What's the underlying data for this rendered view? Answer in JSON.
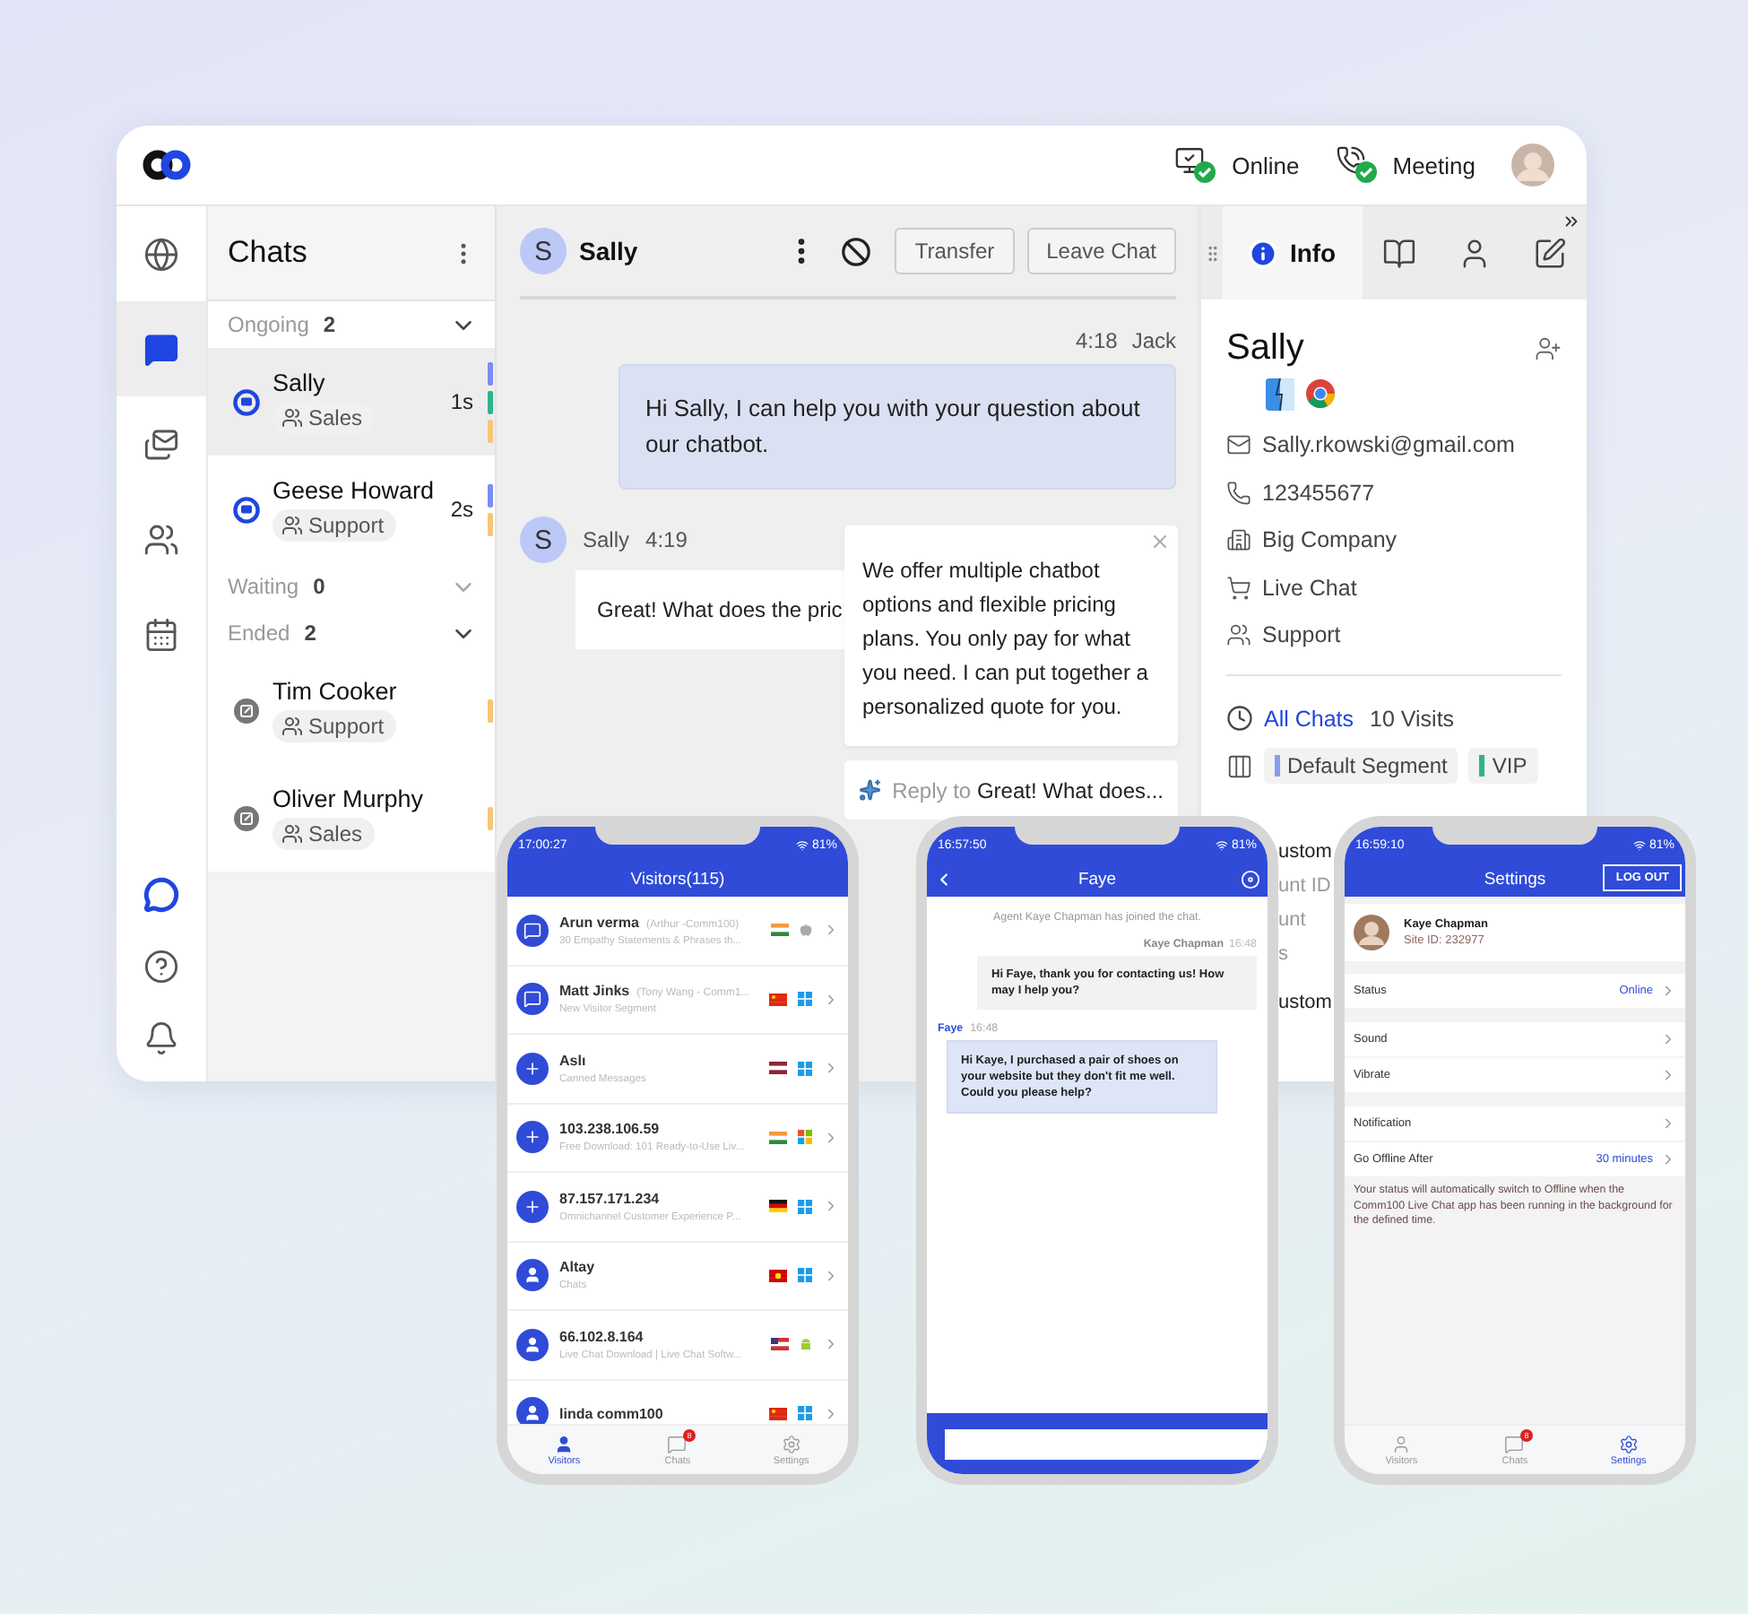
{
  "topbar": {
    "statuses": [
      {
        "kind": "online",
        "label": "Online"
      },
      {
        "kind": "meeting",
        "label": "Meeting"
      }
    ]
  },
  "nav": {
    "items": [
      {
        "kind": "globe",
        "selected": false
      },
      {
        "kind": "chats",
        "selected": true
      },
      {
        "kind": "messages",
        "selected": false
      },
      {
        "kind": "teams",
        "selected": false
      },
      {
        "kind": "calendar",
        "selected": false
      }
    ],
    "bottom": [
      {
        "kind": "brand"
      },
      {
        "kind": "help"
      },
      {
        "kind": "notifications"
      }
    ]
  },
  "chat_list": {
    "title": "Chats",
    "sections": [
      {
        "label": "Ongoing",
        "count": "2",
        "items": [
          {
            "kind": "active",
            "name": "Sally",
            "tag": "Sales",
            "time": "1s",
            "selected": true,
            "marks": [
              {
                "color": "#7b8cf5"
              },
              {
                "color": "#2bb58e"
              },
              {
                "color": "#f6c576"
              }
            ]
          },
          {
            "kind": "active",
            "name": "Geese Howard",
            "tag": "Support",
            "time": "2s",
            "selected": false,
            "marks": [
              {
                "color": "#7b8cf5"
              },
              {
                "color": "#f6c576"
              }
            ]
          }
        ]
      },
      {
        "label": "Waiting",
        "count": "0"
      },
      {
        "label": "Ended",
        "count": "2",
        "items": [
          {
            "kind": "ended",
            "name": "Tim Cooker",
            "tag": "Support",
            "selected": false,
            "marks": [
              {
                "color": "#f6c576"
              }
            ]
          },
          {
            "kind": "ended",
            "name": "Oliver Murphy",
            "tag": "Sales",
            "selected": false,
            "marks": [
              {
                "color": "#f6c576"
              }
            ]
          }
        ]
      }
    ]
  },
  "conversation": {
    "contact": {
      "initial": "S",
      "name": "Sally"
    },
    "actions": [
      "Transfer",
      "Leave Chat"
    ],
    "messages": [
      {
        "kind": "agent",
        "time": "4:18",
        "author": "Jack",
        "text": "Hi Sally, I can help you with your question about our chatbot."
      },
      {
        "kind": "visitor",
        "initial": "S",
        "author": "Sally",
        "time": "4:19",
        "text": "Great! What does the pric"
      }
    ],
    "suggestion": {
      "text": "We offer multiple chatbot options and flexible pricing plans. You only pay for what you need. I can put together a personalized quote for you."
    },
    "reply": {
      "prefix": "Reply to",
      "quote": "Great! What does..."
    }
  },
  "info": {
    "tabs": [
      {
        "kind": "info",
        "label": "Info",
        "selected": true
      },
      {
        "kind": "book",
        "selected": false
      },
      {
        "kind": "person",
        "selected": false
      },
      {
        "kind": "notes",
        "selected": false
      }
    ],
    "name": "Sally",
    "details": [
      {
        "kind": "email",
        "text": "Sally.rkowski@gmail.com"
      },
      {
        "kind": "phone",
        "text": "123455677"
      },
      {
        "kind": "company",
        "text": "Big Company"
      },
      {
        "kind": "cart",
        "text": "Live Chat"
      },
      {
        "kind": "team",
        "text": "Support"
      }
    ],
    "history": {
      "link": "All Chats",
      "visits": "10 Visits"
    },
    "segments": [
      {
        "label": "Default Segment",
        "color": "#8a9cf0"
      },
      {
        "label": "VIP",
        "color": "#2bb58e"
      }
    ],
    "fragments": [
      {
        "kind": "heading",
        "text": "ustom"
      },
      {
        "kind": "field",
        "text": "unt ID"
      },
      {
        "kind": "field",
        "text": "unt"
      },
      {
        "kind": "field",
        "text": "s"
      },
      {
        "kind": "heading",
        "text": "ustom"
      }
    ]
  },
  "phones": [
    {
      "kind": "visitors",
      "clock": "17:00:27",
      "battery": "81%",
      "title": "Visitors(115)",
      "visitors": [
        {
          "kind": "chat",
          "name": "Arun verma",
          "alias": "(Arthur -Comm100)",
          "subtitle": "30 Empathy Statements & Phrases th...",
          "flag": {
            "kind": "india"
          },
          "os": {
            "kind": "apple"
          }
        },
        {
          "kind": "chat",
          "name": "Matt Jinks",
          "alias": "(Tony Wang - Comm1...",
          "subtitle": "New Visitor Segment",
          "flag": {
            "kind": "china"
          },
          "os": {
            "kind": "windows"
          }
        },
        {
          "kind": "plus",
          "name": "Aslı",
          "subtitle": "Canned Messages",
          "flag": {
            "kind": "latvia"
          },
          "os": {
            "kind": "windows"
          }
        },
        {
          "kind": "plus",
          "name": "103.238.106.59",
          "subtitle": "Free Download: 101 Ready-to-Use Liv...",
          "flag": {
            "kind": "india"
          },
          "os": {
            "kind": "windows-classic"
          }
        },
        {
          "kind": "plus",
          "name": "87.157.171.234",
          "subtitle": "Omnichannel Customer Experience P...",
          "flag": {
            "kind": "germany"
          },
          "os": {
            "kind": "windows"
          }
        },
        {
          "kind": "person",
          "name": "Altay",
          "subtitle": "Chats",
          "flag": {
            "kind": "macedonia"
          },
          "os": {
            "kind": "windows"
          }
        },
        {
          "kind": "person",
          "name": "66.102.8.164",
          "subtitle": "Live Chat Download | Live Chat Softw...",
          "flag": {
            "kind": "usa"
          },
          "os": {
            "kind": "android"
          }
        },
        {
          "kind": "person",
          "name": "linda comm100",
          "flag": {
            "kind": "china"
          },
          "os": {
            "kind": "windows"
          }
        }
      ],
      "tabs": [
        {
          "kind": "visitors",
          "label": "Visitors",
          "selected": true
        },
        {
          "kind": "chats",
          "label": "Chats",
          "badge": "8",
          "selected": false
        },
        {
          "kind": "settings",
          "label": "Settings",
          "selected": false
        }
      ]
    },
    {
      "kind": "chat",
      "clock": "16:57:50",
      "battery": "81%",
      "title": "Faye",
      "messages": [
        {
          "kind": "system",
          "text": "Agent Kaye Chapman has joined the chat."
        },
        {
          "kind": "agent",
          "author": "Kaye Chapman",
          "time": "16:48",
          "text": "Hi Faye, thank you for contacting us! How may I help you?"
        },
        {
          "kind": "visitor",
          "author": "Faye",
          "time": "16:48",
          "text": "Hi Kaye, I purchased a pair of shoes on your website but they don't fit me well. Could you please help?"
        }
      ]
    },
    {
      "kind": "settings",
      "clock": "16:59:10",
      "battery": "81%",
      "title": "Settings",
      "action": "LOG OUT",
      "profile": {
        "name": "Kaye Chapman",
        "site_id": "Site ID: 232977"
      },
      "groups": [
        [
          {
            "label": "Status",
            "value": "Online"
          }
        ],
        [
          {
            "label": "Sound"
          },
          {
            "label": "Vibrate"
          }
        ],
        [
          {
            "label": "Notification"
          },
          {
            "label": "Go Offline After",
            "value": "30 minutes"
          }
        ]
      ],
      "note": "Your status will automatically switch to Offline when the Comm100 Live Chat app has been running in the background for the defined time.",
      "tabs": [
        {
          "kind": "visitors",
          "label": "Visitors",
          "selected": false
        },
        {
          "kind": "chats",
          "label": "Chats",
          "badge": "8",
          "selected": false
        },
        {
          "kind": "settings",
          "label": "Settings",
          "selected": true
        }
      ]
    }
  ]
}
